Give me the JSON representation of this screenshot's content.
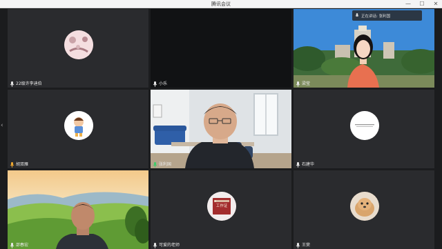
{
  "app": {
    "title": "腾讯会议"
  },
  "speaking": {
    "label": "正在讲话: 张利国"
  },
  "participants": [
    {
      "name": "22级许李迪伯"
    },
    {
      "name": "小乐"
    },
    {
      "name": "梁莹"
    },
    {
      "name": "胡双雁"
    },
    {
      "name": "张利国"
    },
    {
      "name": "石建华"
    },
    {
      "name": "邵春宏"
    },
    {
      "name": "可爱的老师"
    },
    {
      "name": "王荣"
    }
  ],
  "card": {
    "title": "工作证"
  },
  "colors": {
    "tile_bg": "#2a2b2e",
    "grid_bg": "#1b1c1e",
    "mic_on": "#e8e8e8",
    "active": "#f0a830"
  }
}
